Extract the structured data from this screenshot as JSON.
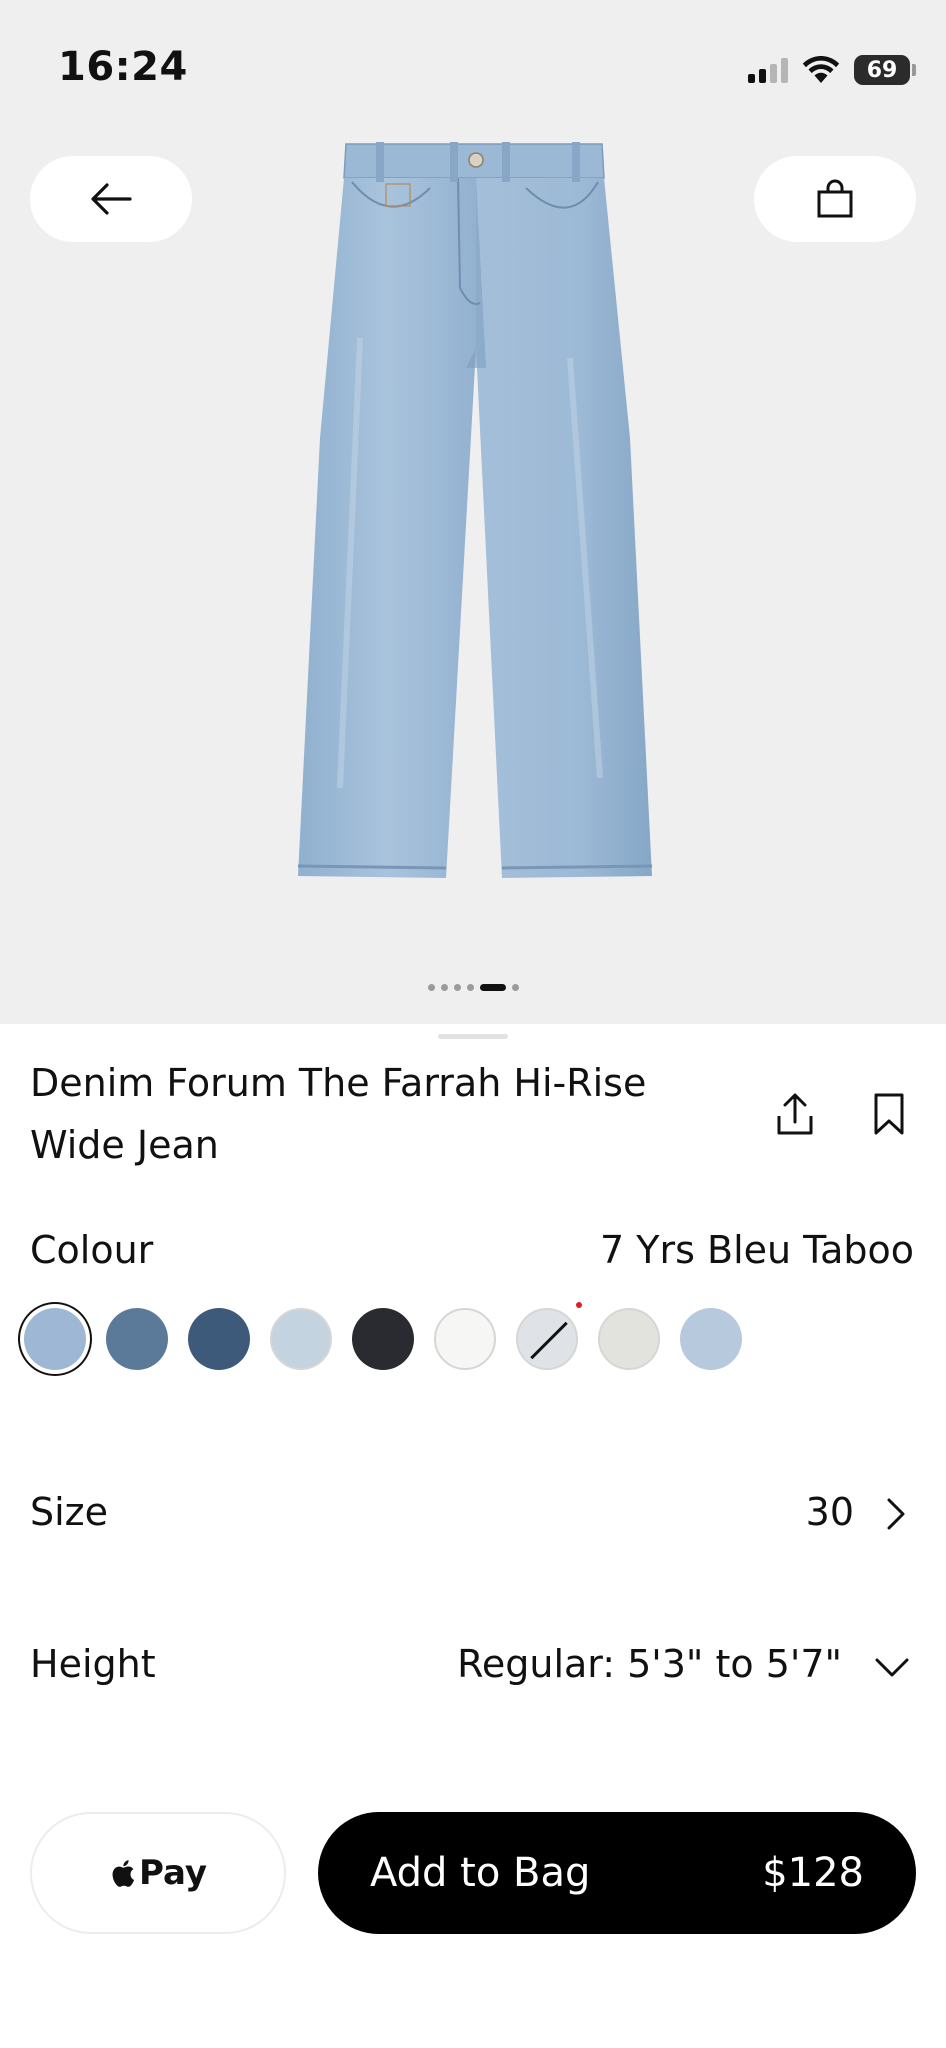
{
  "status_bar": {
    "time": "16:24",
    "battery": "69"
  },
  "header": {
    "back_icon": "arrow-left-icon",
    "bag_icon": "shopping-bag-icon"
  },
  "gallery": {
    "image_count": 6,
    "active_index": 4
  },
  "product": {
    "title": "Denim Forum The Farrah Hi-Rise Wide Jean",
    "share_icon": "share-icon",
    "bookmark_icon": "bookmark-icon"
  },
  "colour": {
    "label": "Colour",
    "selected": "7 Yrs Bleu Taboo",
    "swatches": [
      {
        "color": "#9db7d4",
        "selected": true
      },
      {
        "color": "#5b7a99"
      },
      {
        "color": "#3d5a7a"
      },
      {
        "color": "#c4d3e0"
      },
      {
        "color": "#2a2b30"
      },
      {
        "color": "#f6f6f4"
      },
      {
        "color": "#dfe3e7",
        "unavailable": true
      },
      {
        "color": "#e3e3dd"
      },
      {
        "color": "#b7c9dc"
      }
    ]
  },
  "size": {
    "label": "Size",
    "value": "30"
  },
  "height": {
    "label": "Height",
    "value": "Regular: 5'3\" to 5'7\""
  },
  "actions": {
    "apple_pay_label": "Pay",
    "add_to_bag_label": "Add to Bag",
    "price": "$128"
  }
}
